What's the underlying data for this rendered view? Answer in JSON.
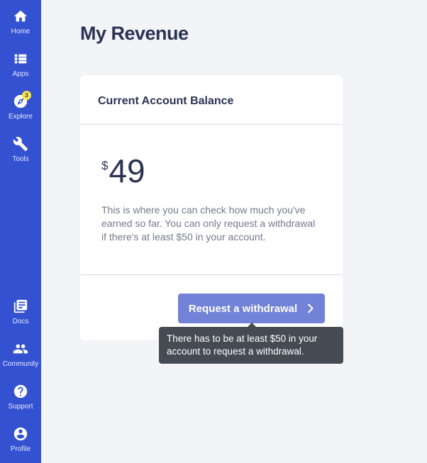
{
  "sidebar": {
    "top_items": [
      {
        "label": "Home",
        "icon": "home-icon"
      },
      {
        "label": "Apps",
        "icon": "apps-icon"
      },
      {
        "label": "Explore",
        "icon": "explore-icon",
        "badge": "3"
      },
      {
        "label": "Tools",
        "icon": "wrench-icon"
      }
    ],
    "bottom_items": [
      {
        "label": "Docs",
        "icon": "docs-icon"
      },
      {
        "label": "Community",
        "icon": "community-icon"
      },
      {
        "label": "Support",
        "icon": "help-icon"
      },
      {
        "label": "Profile",
        "icon": "profile-icon"
      }
    ]
  },
  "page": {
    "title": "My Revenue"
  },
  "card": {
    "title": "Current Account Balance",
    "currency": "$",
    "amount": "49",
    "description": "This is where you can check how much you've earned so far. You can only request a withdrawal if there's at least $50 in your account.",
    "button_label": "Request a withdrawal",
    "tooltip": "There has to be at least $50 in your account to request a withdrawal."
  },
  "colors": {
    "sidebar": "#3451d1",
    "button": "#7282d6",
    "tooltip": "#454b52",
    "badge": "#f5e54a",
    "title": "#2a3353"
  }
}
